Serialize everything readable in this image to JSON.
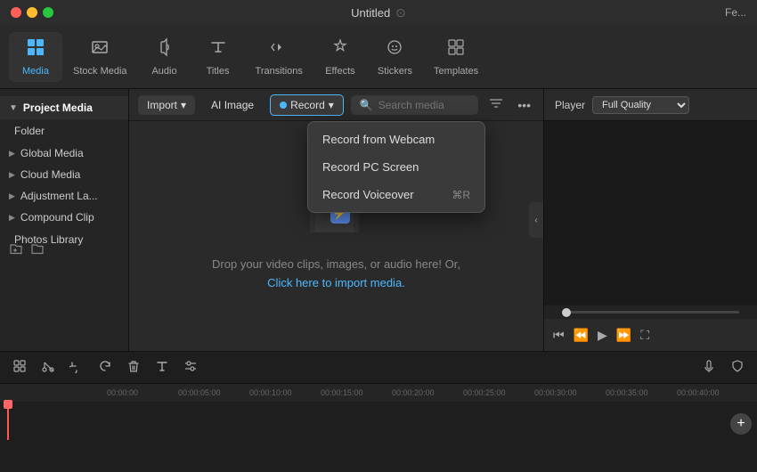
{
  "titleBar": {
    "title": "Untitled",
    "rightLabel": "Fe..."
  },
  "toolbar": {
    "items": [
      {
        "id": "media",
        "label": "Media",
        "icon": "▦",
        "active": true
      },
      {
        "id": "stock-media",
        "label": "Stock Media",
        "icon": "🎬"
      },
      {
        "id": "audio",
        "label": "Audio",
        "icon": "♪"
      },
      {
        "id": "titles",
        "label": "Titles",
        "icon": "T"
      },
      {
        "id": "transitions",
        "label": "Transitions",
        "icon": "↩"
      },
      {
        "id": "effects",
        "label": "Effects",
        "icon": "✦"
      },
      {
        "id": "stickers",
        "label": "Stickers",
        "icon": "★"
      },
      {
        "id": "templates",
        "label": "Templates",
        "icon": "⊞"
      }
    ]
  },
  "sidebar": {
    "projectMedia": {
      "label": "Project Media"
    },
    "items": [
      {
        "label": "Folder"
      },
      {
        "label": "Global Media",
        "hasArrow": true
      },
      {
        "label": "Cloud Media",
        "hasArrow": true
      },
      {
        "label": "Adjustment La...",
        "hasArrow": true
      },
      {
        "label": "Compound Clip",
        "hasArrow": true
      },
      {
        "label": "Photos Library"
      }
    ]
  },
  "mediaToolbar": {
    "importLabel": "Import",
    "aiImageLabel": "AI Image",
    "recordLabel": "Record",
    "searchPlaceholder": "Search media"
  },
  "recordDropdown": {
    "items": [
      {
        "label": "Record from Webcam",
        "shortcut": ""
      },
      {
        "label": "Record PC Screen",
        "shortcut": ""
      },
      {
        "label": "Record Voiceover",
        "shortcut": "⌘R"
      }
    ]
  },
  "dropArea": {
    "text": "Drop your video clips, images, or audio here! Or,",
    "linkText": "Click here to import media."
  },
  "player": {
    "label": "Player",
    "quality": "Full Quality"
  },
  "timeline": {
    "labels": [
      "00:00:00",
      "00:00:05:00",
      "00:00:10:00",
      "00:00:15:00",
      "00:00:20:00",
      "00:00:25:00",
      "00:00:30:00",
      "00:00:35:00",
      "00:00:40:00"
    ]
  },
  "bottomTools": {
    "tools": [
      "✂",
      "⊞",
      "↩",
      "→",
      "🗑",
      "T",
      "≡",
      "⚙"
    ]
  }
}
